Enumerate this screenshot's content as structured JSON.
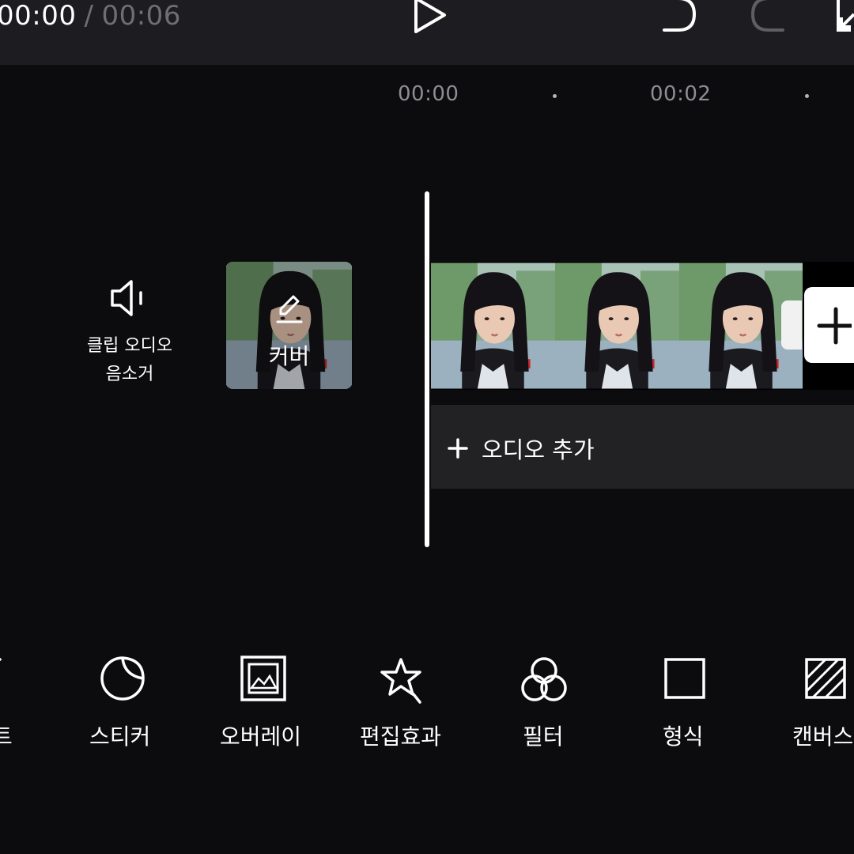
{
  "header": {
    "current_time": "00:00",
    "separator": "/",
    "total_time": "00:06"
  },
  "icons": {
    "play": "play-icon",
    "undo": "undo-icon",
    "redo": "redo-icon",
    "fullscreen": "fullscreen-icon"
  },
  "timeline": {
    "ruler_labels": [
      "00:00",
      "00:02"
    ]
  },
  "left_panel": {
    "mute_label": "클립 오디오\n음소거",
    "cover_label": "커버"
  },
  "audio_track": {
    "add_label": "오디오 추가"
  },
  "toolbar": {
    "items": [
      {
        "label": "트",
        "icon": "text-icon"
      },
      {
        "label": "스티커",
        "icon": "sticker-icon"
      },
      {
        "label": "오버레이",
        "icon": "overlay-icon"
      },
      {
        "label": "편집효과",
        "icon": "effects-icon"
      },
      {
        "label": "필터",
        "icon": "filter-icon"
      },
      {
        "label": "형식",
        "icon": "format-icon"
      },
      {
        "label": "캔버스",
        "icon": "canvas-icon"
      }
    ]
  },
  "colors": {
    "background": "#0c0b0e",
    "topbar": "#1d1c20",
    "audio_track": "#222124",
    "muted_text": "#8e8d92"
  }
}
